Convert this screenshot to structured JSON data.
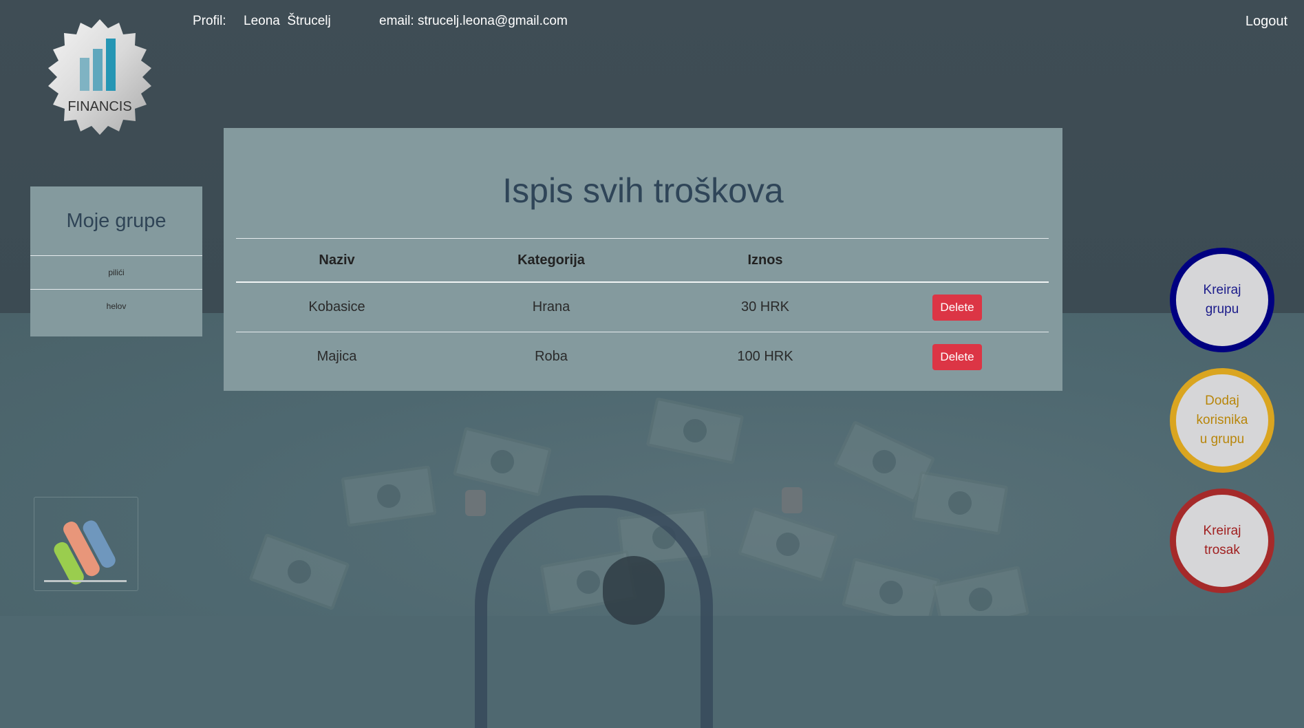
{
  "header": {
    "profile_label": "Profil:",
    "user_name": "Leona  Štrucelj",
    "email_text": "email: strucelj.leona@gmail.com",
    "logout_label": "Logout"
  },
  "logo": {
    "text": "FINANCIS",
    "icon": "bar-chart-seal-icon"
  },
  "sidebar": {
    "title": "Moje grupe",
    "items": [
      {
        "label": "pilići"
      },
      {
        "label": "helov"
      }
    ]
  },
  "main": {
    "title": "Ispis svih troškova",
    "columns": [
      "Naziv",
      "Kategorija",
      "Iznos",
      ""
    ],
    "rows": [
      {
        "naziv": "Kobasice",
        "kategorija": "Hrana",
        "iznos": "30 HRK",
        "action": "Delete"
      },
      {
        "naziv": "Majica",
        "kategorija": "Roba",
        "iznos": "100 HRK",
        "action": "Delete"
      }
    ]
  },
  "actions": {
    "create_group": {
      "line1": "Kreiraj",
      "line2": "grupu",
      "border": "#000080",
      "text_color": "#1b1b8a"
    },
    "add_user": {
      "line1": "Dodaj",
      "line2": "korisnika",
      "line3": "u grupu",
      "border": "#daa520",
      "text_color": "#b8860b"
    },
    "create_expense": {
      "line1": "Kreiraj",
      "line2": "trosak",
      "border": "#a52a2a",
      "text_color": "#a01f1f"
    }
  },
  "colors": {
    "delete": "#dc3545",
    "panel": "#849a9e",
    "header_bg": "#3f4d55"
  }
}
